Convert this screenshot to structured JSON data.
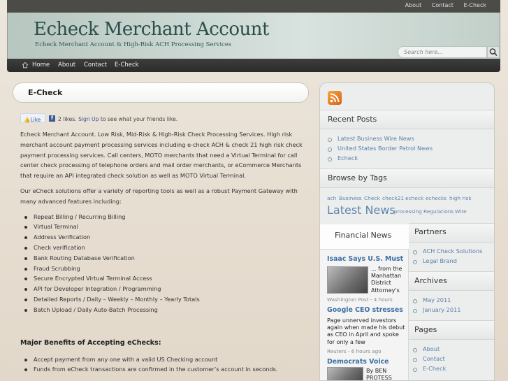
{
  "topbar": {
    "links": [
      "About",
      "Contact",
      "E-Check"
    ]
  },
  "header": {
    "title": "Echeck Merchant Account",
    "tagline": "Echeck Merchant Account & High-Risk ACH Processing Services",
    "search_placeholder": "Search here..."
  },
  "nav": {
    "items": [
      "Home",
      "About",
      "Contact",
      "E-Check"
    ]
  },
  "main": {
    "heading": "E-Check",
    "like": {
      "button": "Like",
      "count_text": "2 likes.",
      "signup": "Sign Up",
      "rest": "to see what your friends like."
    },
    "para1": "Echeck Merchant Account. Low Risk, Mid-Risk & High-Risk Check Processing Services. High risk merchant account payment processing services including e-check ACH & check 21 high risk check payment processing services. Call centers, MOTO merchants that need a Virtual Terminal for call center check processing of telephone orders and mail order merchants, or eCommerce Merchants that require an API integrated check solution as well as MOTO Virtual Terminal.",
    "para2": "Our eCheck solutions offer a variety of reporting tools as well as a robust Payment Gateway with many advanced features including:",
    "features": [
      "Repeat Billing / Recurring Billing",
      "Virtual Terminal",
      "Address Verification",
      "Check verification",
      "Bank Routing Database Verification",
      "Fraud Scrubbing",
      "Secure Encrypted Virtual Terminal Access",
      "API for Developer Integration / Programming",
      "Detailed Reports / Daily – Weekly – Monthly – Yearly Totals",
      "Batch Upload / Daily Auto-Batch Processing"
    ],
    "benefits_heading": "Major Benefits of Accepting eChecks:",
    "benefits": [
      "Accept payment from any one with a valid US Checking account",
      "Funds from eCheck transactions are confirmed in the customer’s account in seconds."
    ]
  },
  "sidebar": {
    "recent_title": "Recent Posts",
    "recent": [
      "Latest Business Wire News",
      "United States Border Patrol News",
      "Echeck"
    ],
    "tags_title": "Browse by Tags",
    "tags_row1": [
      "ach",
      "Business",
      "Check",
      "check21",
      "echeck",
      "echecks",
      "high risk"
    ],
    "tags_row2": [
      "Latest News",
      "processing",
      "Regulations",
      "Wire"
    ],
    "news_title": "Financial News",
    "news": [
      {
        "headline": "Isaac Says U.S. Must",
        "text": "... from the Manhattan District Attorney's",
        "source": "Washington Post - 4 hours"
      },
      {
        "headline": "Google CEO stresses",
        "text": "Page unnerved investors again when made his debut as CEO in April and spoke for only a few",
        "source": "Reuters - 6 hours ago"
      },
      {
        "headline": "Democrats Voice",
        "text": "By BEN PROTESS",
        "source": ""
      }
    ],
    "partners_title": "Partners",
    "partners": [
      "ACH Check Solutions",
      "Legal Brand"
    ],
    "archives_title": "Archives",
    "archives": [
      "May 2011",
      "January 2011"
    ],
    "pages_title": "Pages",
    "pages": [
      "About",
      "Contact",
      "E-Check"
    ]
  }
}
